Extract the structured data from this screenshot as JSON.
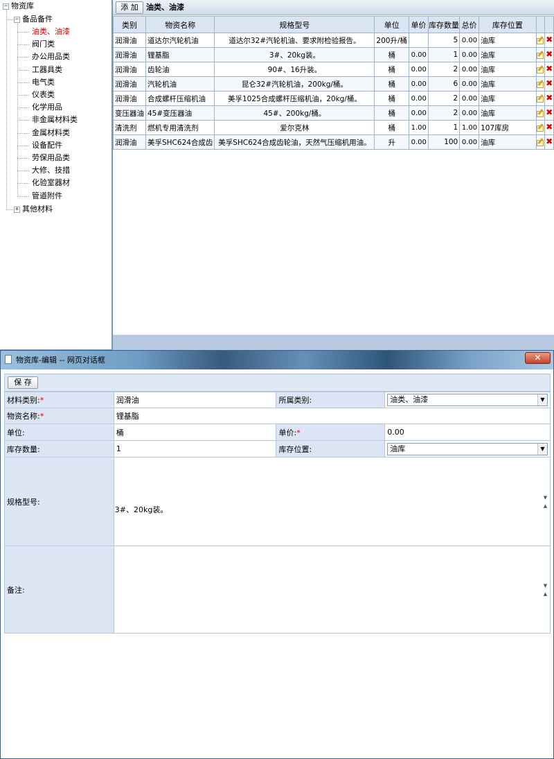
{
  "tree": {
    "root": "物资库",
    "group": "备品备件",
    "children": [
      "油类、油漆",
      "阀门类",
      "办公用品类",
      "工器具类",
      "电气类",
      "仪表类",
      "化学用品",
      "非金属材料类",
      "金属材料类",
      "设备配件",
      "劳保用品类",
      "大修、技措",
      "化验室器材",
      "管道附件"
    ],
    "selected_index": 0,
    "other": "其他材料",
    "expanded_symbol": "−",
    "collapsed_symbol": "+"
  },
  "grid": {
    "add_label": "添 加",
    "title": "油类、油漆",
    "columns": [
      "类别",
      "物资名称",
      "规格型号",
      "单位",
      "单价",
      "库存数量",
      "总价",
      "库存位置"
    ],
    "rows": [
      [
        "润滑油",
        "道达尔汽轮机油",
        "道达尔32#汽轮机油、要求附检验报告。",
        "200升/桶",
        "",
        "5",
        "0.00",
        "油库"
      ],
      [
        "润滑油",
        "锂基脂",
        "3#、20kg装。",
        "桶",
        "0.00",
        "1",
        "0.00",
        "油库"
      ],
      [
        "润滑油",
        "齿轮油",
        "90#、16升装。",
        "桶",
        "0.00",
        "2",
        "0.00",
        "油库"
      ],
      [
        "润滑油",
        "汽轮机油",
        "昆仑32#汽轮机油，200kg/桶。",
        "桶",
        "0.00",
        "6",
        "0.00",
        "油库"
      ],
      [
        "润滑油",
        "合成螺杆压缩机油",
        "美孚1025合成螺杆压缩机油，20kg/桶。",
        "桶",
        "0.00",
        "2",
        "0.00",
        "油库"
      ],
      [
        "变压器油",
        "45#变压器油",
        "45#、200kg/桶。",
        "桶",
        "0.00",
        "2",
        "0.00",
        "油库"
      ],
      [
        "清洗剂",
        "燃机专用清洗剂",
        "爱尔克林",
        "桶",
        "1.00",
        "1",
        "1.00",
        "107库房"
      ],
      [
        "润滑油",
        "美孚SHC624合成齿",
        "美孚SHC624合成齿轮油，天然气压缩机用油。",
        "升",
        "0.00",
        "100",
        "0.00",
        "油库"
      ]
    ],
    "edit_icon": "edit-icon",
    "delete_icon": "delete-icon",
    "delete_glyph": "✖"
  },
  "dialog": {
    "title": "物资库-编辑 -- 网页对话框",
    "close_glyph": "✕",
    "save_label": "保 存",
    "required_mark": "*",
    "fields": {
      "material_type_label": "材料类别:",
      "material_type_value": "润滑油",
      "category_label": "所属类别:",
      "category_value": "油类、油漆",
      "name_label": "物资名称:",
      "name_value": "锂基脂",
      "unit_label": "单位:",
      "unit_value": "桶",
      "price_label": "单价:",
      "price_value": "0.00",
      "stock_label": "库存数量:",
      "stock_value": "1",
      "location_label": "库存位置:",
      "location_value": "油库",
      "spec_label": "规格型号:",
      "spec_value": "3#、20kg装。",
      "remark_label": "备注:",
      "remark_value": ""
    }
  }
}
